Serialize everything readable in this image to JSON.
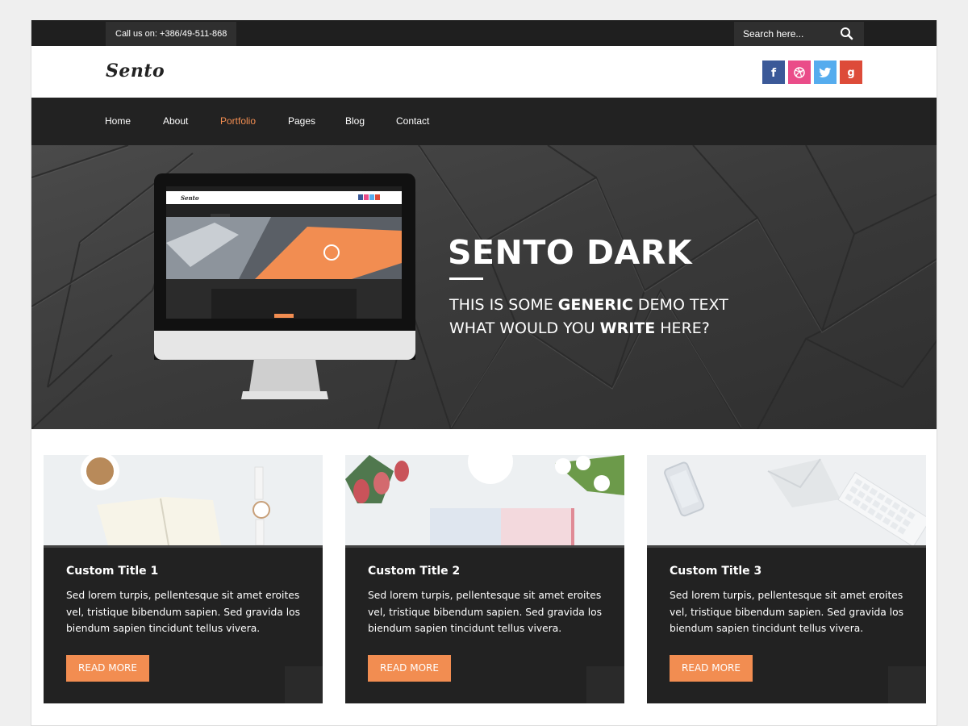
{
  "topbar": {
    "call_text": "Call us on: +386/49-511-868",
    "search_placeholder": "Search here..."
  },
  "header": {
    "logo": "Sento",
    "social": [
      {
        "icon": "facebook-icon",
        "glyph": "f",
        "color": "#3b5998"
      },
      {
        "icon": "dribbble-icon",
        "glyph": "",
        "color": "#ea4c89"
      },
      {
        "icon": "twitter-icon",
        "glyph": "",
        "color": "#55acee"
      },
      {
        "icon": "google-plus-icon",
        "glyph": "g",
        "color": "#dd4b39"
      }
    ]
  },
  "nav": {
    "items": [
      "Home",
      "About",
      "Portfolio",
      "Pages",
      "Blog",
      "Contact"
    ],
    "active": "Portfolio",
    "active_color": "#f28d51"
  },
  "hero": {
    "title": "SENTO DARK",
    "line1_a": "THIS IS SOME ",
    "line1_b": "GENERIC",
    "line1_c": " DEMO TEXT",
    "line2_a": "WHAT WOULD YOU ",
    "line2_b": "WRITE",
    "line2_c": " HERE?"
  },
  "cards": [
    {
      "title": "Custom Title 1",
      "text": "Sed lorem turpis, pellentesque sit amet eroites vel, tristique bibendum sapien. Sed gravida los biendum sapien tincidunt tellus vivera.",
      "button": "READ MORE"
    },
    {
      "title": "Custom Title 2",
      "text": "Sed lorem turpis, pellentesque sit amet eroites vel, tristique bibendum sapien. Sed gravida los biendum sapien tincidunt tellus vivera.",
      "button": "READ MORE"
    },
    {
      "title": "Custom Title 3",
      "text": "Sed lorem turpis, pellentesque sit amet eroites vel, tristique bibendum sapien. Sed gravida los biendum sapien tincidunt tellus vivera.",
      "button": "READ MORE"
    }
  ],
  "colors": {
    "accent": "#f28d51",
    "dark": "#222222",
    "topbar": "#1f1f1f"
  }
}
